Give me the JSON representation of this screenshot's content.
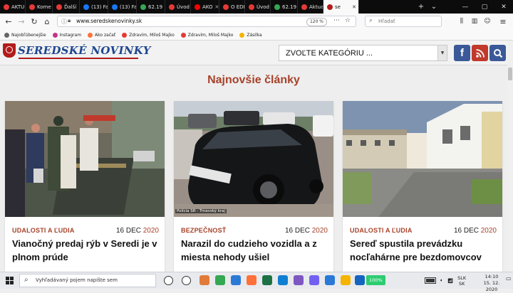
{
  "browser": {
    "tabs": [
      {
        "label": "AKTU",
        "color": "#e53935"
      },
      {
        "label": "Kome",
        "color": "#e53935"
      },
      {
        "label": "Ďalší",
        "color": "#e53935"
      },
      {
        "label": "(13) Fa",
        "color": "#1877f2"
      },
      {
        "label": "(13) Fa",
        "color": "#1877f2"
      },
      {
        "label": "62.19",
        "color": "#34a853"
      },
      {
        "label": "Úvod",
        "color": "#e53935"
      },
      {
        "label": "AKO",
        "color": "#ff0000"
      },
      {
        "label": "O EDI",
        "color": "#e53935"
      },
      {
        "label": "Úvod",
        "color": "#e53935"
      },
      {
        "label": "62.19",
        "color": "#34a853"
      },
      {
        "label": "Aktua",
        "color": "#e53935"
      },
      {
        "label": "se",
        "color": "#b31b1b"
      }
    ],
    "url": "www.seredskenovinky.sk",
    "zoom": "120 %",
    "search_placeholder": "Hľadať",
    "bookmarks": [
      {
        "label": "Najobľúbenejšie",
        "icon": "gear-icon",
        "color": "#666666"
      },
      {
        "label": "Instagram",
        "icon": "instagram-icon",
        "color": "#c13584"
      },
      {
        "label": "Ako začať",
        "icon": "firefox-icon",
        "color": "#ff7139"
      },
      {
        "label": "Zdravím, Miloš Majko",
        "icon": "red-icon",
        "color": "#e53935"
      },
      {
        "label": "Zdravím, Miloš Majko",
        "icon": "red-icon",
        "color": "#e53935"
      },
      {
        "label": "Zásilka",
        "icon": "star-icon",
        "color": "#f4b400"
      }
    ]
  },
  "site": {
    "logo_text": "Seredské novinky",
    "category_select": "ZVOĽTE KATEGÓRIU ...",
    "social": [
      {
        "name": "facebook-button",
        "glyph": "f",
        "color": "#3b5998"
      },
      {
        "name": "rss-button",
        "glyph": "",
        "color": "#c0392b"
      },
      {
        "name": "search-button",
        "glyph": "",
        "color": "#3b5998"
      }
    ]
  },
  "main": {
    "section_title": "Najnovšie články",
    "articles": [
      {
        "category": "UDALOSTI A ĽUDIA",
        "date_day": "16 DEC",
        "date_year": "2020",
        "title": "Vianočný predaj rýb v Seredi je v plnom prúde",
        "image_caption": ""
      },
      {
        "category": "BEZPEČNOSŤ",
        "date_day": "16 DEC",
        "date_year": "2020",
        "title": "Narazil do cudzieho vozidla a z miesta nehody ušiel",
        "image_caption": "Polícia SR - Trnavský kraj"
      },
      {
        "category": "UDALOSTI A ĽUDIA",
        "date_day": "16 DEC",
        "date_year": "2020",
        "title": "Sereď spustila prevádzku nocľahárne pre bezdomovcov",
        "image_caption": ""
      }
    ]
  },
  "taskbar": {
    "search_placeholder": "Vyhľadávaný pojem napíšte sem",
    "battery": "100%",
    "language": "SLK",
    "language2": "SK",
    "time": "14:10",
    "date": "15. 12. 2020"
  }
}
